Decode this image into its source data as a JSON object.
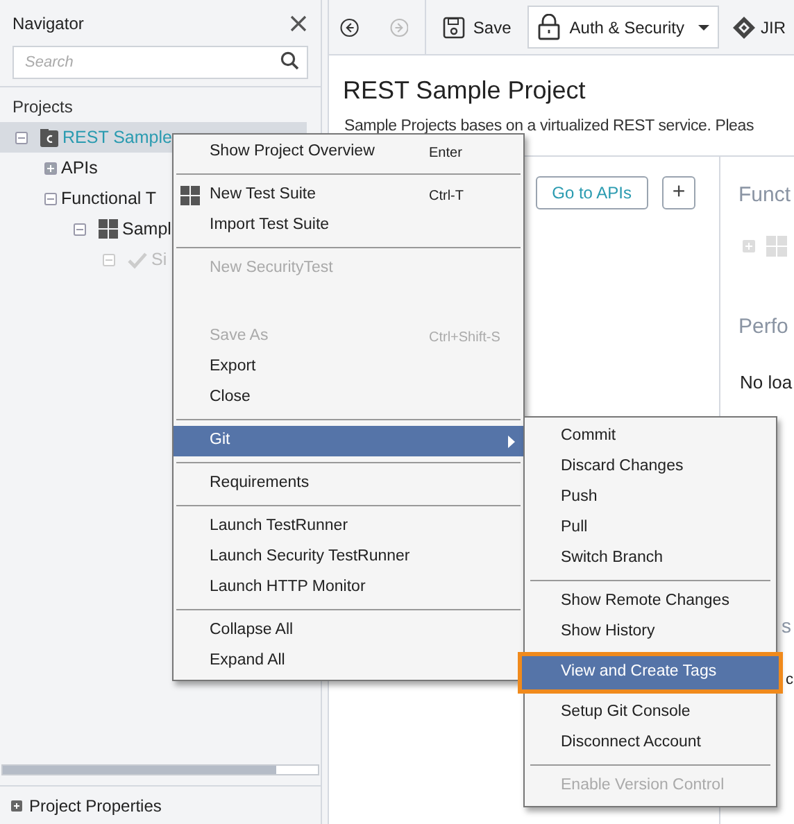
{
  "navigator": {
    "title": "Navigator",
    "search": {
      "placeholder": "Search"
    },
    "section": "Projects",
    "tree": [
      {
        "label": "REST Sample",
        "kind": "project",
        "selected": true,
        "expanded": true,
        "children": [
          {
            "label": "APIs",
            "expanded": false,
            "faded": false
          },
          {
            "label": "Functional T",
            "expanded": true,
            "faded": false,
            "children": [
              {
                "label": "Sampl",
                "kind": "suite",
                "expanded": true,
                "faded": false,
                "children": [
                  {
                    "label": "Si",
                    "kind": "case",
                    "expanded": true,
                    "faded": true
                  }
                ]
              }
            ]
          }
        ]
      }
    ],
    "footer": "Project Properties"
  },
  "toolbar": {
    "save": "Save",
    "auth": "Auth & Security",
    "jira": "JIR"
  },
  "main": {
    "title": "REST Sample Project",
    "description": "Sample Projects bases on a virtualized REST service. Pleas",
    "go_button": "Go to APIs",
    "add_button": "+",
    "right_texts": [
      "Funct",
      "Perfo",
      "No loa",
      "s",
      "c"
    ]
  },
  "context_menu": [
    {
      "kind": "item",
      "label": "Show Project Overview",
      "shortcut": "Enter",
      "disabled": false,
      "selected": false
    },
    {
      "kind": "separator"
    },
    {
      "kind": "grid_item",
      "label": "New Test Suite",
      "shortcut": "Ctrl-T",
      "disabled": false,
      "selected": false
    },
    {
      "kind": "item",
      "label": "Import Test Suite",
      "disabled": false,
      "selected": false
    },
    {
      "kind": "separator"
    },
    {
      "kind": "item",
      "label": "New SecurityTest",
      "disabled": true,
      "selected": false
    },
    {
      "kind": "gap"
    },
    {
      "kind": "item",
      "label": "Save As",
      "shortcut": "Ctrl+Shift-S",
      "disabled": true,
      "selected": false
    },
    {
      "kind": "item",
      "label": "Export",
      "disabled": false,
      "selected": false
    },
    {
      "kind": "item",
      "label": "Close",
      "disabled": false,
      "selected": false
    },
    {
      "kind": "separator"
    },
    {
      "kind": "item",
      "label": "Git",
      "submenu": true,
      "disabled": false,
      "selected": true
    },
    {
      "kind": "separator"
    },
    {
      "kind": "item",
      "label": "Requirements",
      "disabled": false,
      "selected": false
    },
    {
      "kind": "separator"
    },
    {
      "kind": "item",
      "label": "Launch TestRunner",
      "disabled": false,
      "selected": false
    },
    {
      "kind": "item",
      "label": "Launch Security TestRunner",
      "disabled": false,
      "selected": false
    },
    {
      "kind": "item",
      "label": "Launch HTTP Monitor",
      "disabled": false,
      "selected": false
    },
    {
      "kind": "separator"
    },
    {
      "kind": "item",
      "label": "Collapse All",
      "disabled": false,
      "selected": false
    },
    {
      "kind": "item",
      "label": "Expand All",
      "disabled": false,
      "selected": false
    }
  ],
  "git_submenu": [
    {
      "kind": "item",
      "label": "Commit",
      "disabled": false,
      "selected": false
    },
    {
      "kind": "item",
      "label": "Discard Changes",
      "disabled": false,
      "selected": false
    },
    {
      "kind": "item",
      "label": "Push",
      "disabled": false,
      "selected": false
    },
    {
      "kind": "item",
      "label": "Pull",
      "disabled": false,
      "selected": false
    },
    {
      "kind": "item",
      "label": "Switch Branch",
      "disabled": false,
      "selected": false
    },
    {
      "kind": "separator"
    },
    {
      "kind": "item",
      "label": "Show Remote Changes",
      "disabled": false,
      "selected": false
    },
    {
      "kind": "item",
      "label": "Show History",
      "disabled": false,
      "selected": false
    },
    {
      "kind": "item",
      "label": "View and Create Tags",
      "disabled": false,
      "selected": true,
      "highlighted": true
    },
    {
      "kind": "item",
      "label": "Setup Git Console",
      "disabled": false,
      "selected": false
    },
    {
      "kind": "item",
      "label": "Disconnect Account",
      "disabled": false,
      "selected": false
    },
    {
      "kind": "separator"
    },
    {
      "kind": "item",
      "label": "Enable Version Control",
      "disabled": true,
      "selected": false
    }
  ]
}
